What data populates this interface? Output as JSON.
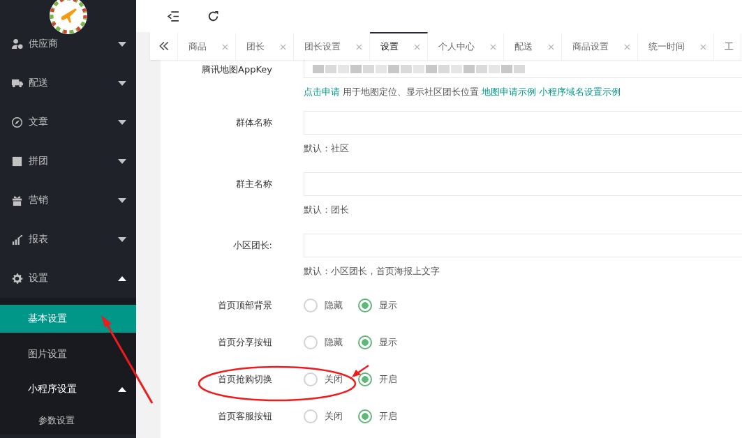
{
  "sidebar": {
    "items": [
      {
        "label": "供应商",
        "expanded": false
      },
      {
        "label": "配送",
        "expanded": false
      },
      {
        "label": "文章",
        "expanded": false
      },
      {
        "label": "拼团",
        "expanded": false
      },
      {
        "label": "营销",
        "expanded": false
      },
      {
        "label": "报表",
        "expanded": false
      },
      {
        "label": "设置",
        "expanded": true,
        "children": [
          {
            "label": "基本设置",
            "selected": true
          },
          {
            "label": "图片设置",
            "selected": false
          },
          {
            "label": "小程序设置",
            "selected": false,
            "expanded": true,
            "children": [
              {
                "label": "参数设置",
                "selected": false
              }
            ]
          }
        ]
      }
    ]
  },
  "tabs": [
    {
      "label": "商品",
      "selected": false,
      "closable": true
    },
    {
      "label": "团长",
      "selected": false,
      "closable": true
    },
    {
      "label": "团长设置",
      "selected": false,
      "closable": true
    },
    {
      "label": "设置",
      "selected": true,
      "closable": true
    },
    {
      "label": "个人中心",
      "selected": false,
      "closable": true
    },
    {
      "label": "配送",
      "selected": false,
      "closable": true
    },
    {
      "label": "商品设置",
      "selected": false,
      "closable": true
    },
    {
      "label": "统一时间",
      "selected": false,
      "closable": true
    },
    {
      "label": "工",
      "selected": false,
      "closable": false
    }
  ],
  "form": {
    "fields": [
      {
        "kind": "masked",
        "label": "腾讯地图AppKey",
        "hint": [
          {
            "text": "点击申请",
            "link": true
          },
          {
            "text": "用于地图定位、显示社区团长位置",
            "link": false
          },
          {
            "text": "地图申请示例",
            "link": true
          },
          {
            "text": "小程序域名设置示例",
            "link": true
          }
        ]
      },
      {
        "kind": "text",
        "label": "群体名称",
        "hint": [
          {
            "text": "默认：社区",
            "link": false
          }
        ]
      },
      {
        "kind": "text",
        "label": "群主名称",
        "hint": [
          {
            "text": "默认：团长",
            "link": false
          }
        ]
      },
      {
        "kind": "text",
        "label": "小区团长:",
        "hint": [
          {
            "text": "默认：小区团长，首页海报上文字",
            "link": false
          }
        ]
      },
      {
        "kind": "radio",
        "label": "首页顶部背景",
        "options": [
          {
            "label": "隐藏",
            "selected": false
          },
          {
            "label": "显示",
            "selected": true
          }
        ]
      },
      {
        "kind": "radio",
        "label": "首页分享按钮",
        "options": [
          {
            "label": "隐藏",
            "selected": false
          },
          {
            "label": "显示",
            "selected": true
          }
        ]
      },
      {
        "kind": "radio",
        "label": "首页抢购切换",
        "options": [
          {
            "label": "关闭",
            "selected": false
          },
          {
            "label": "开启",
            "selected": true
          }
        ]
      },
      {
        "kind": "radio",
        "label": "首页客服按钮",
        "options": [
          {
            "label": "关闭",
            "selected": false
          },
          {
            "label": "开启",
            "selected": true
          }
        ]
      }
    ]
  }
}
